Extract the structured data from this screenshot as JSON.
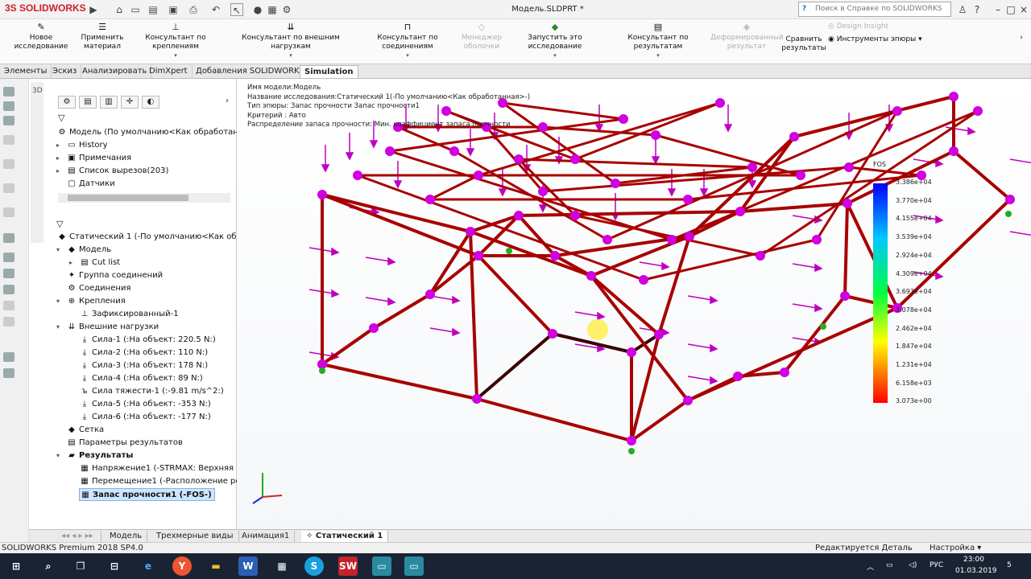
{
  "titlebar": {
    "logo": "SOLIDWORKS",
    "window_title": "Модель.SLDPRT *",
    "help_placeholder": "Поиск в Справке по SOLIDWORKS"
  },
  "commands": [
    {
      "label": "Новое исследование",
      "enabled": true
    },
    {
      "label": "Применить материал",
      "enabled": true
    },
    {
      "label": "Консультант по креплениям",
      "enabled": true
    },
    {
      "label": "Консультант по внешним нагрузкам",
      "enabled": true
    },
    {
      "label": "Консультант по соединениям",
      "enabled": true
    },
    {
      "label": "Менеджер оболочки",
      "enabled": false
    },
    {
      "label": "Запустить это исследование",
      "enabled": true
    },
    {
      "label": "Консультант по результатам",
      "enabled": true
    },
    {
      "label": "Деформированный результат",
      "enabled": false
    },
    {
      "label": "Сравнить результаты",
      "enabled": true
    },
    {
      "label": "Design Insight",
      "enabled": false
    },
    {
      "label": "Инструменты эпюры",
      "enabled": true
    }
  ],
  "tabs": [
    "Элементы",
    "Эскиз",
    "Анализировать",
    "DimXpert",
    "Добавления SOLIDWORKS",
    "Simulation"
  ],
  "active_tab": "Simulation",
  "tree_top": [
    {
      "label": "Модель  (По умолчанию<Как обработан"
    },
    {
      "label": "History"
    },
    {
      "label": "Примечания"
    },
    {
      "label": "Список вырезов(203)"
    },
    {
      "label": "Датчики"
    }
  ],
  "study_tree": [
    {
      "label": "Статический 1 (-По умолчанию<Как обрабо"
    },
    {
      "label": "Модель"
    },
    {
      "label": "Cut list"
    },
    {
      "label": "Группа соединений"
    },
    {
      "label": "Соединения"
    },
    {
      "label": "Крепления"
    },
    {
      "label": "Зафиксированный-1"
    },
    {
      "label": "Внешние нагрузки"
    },
    {
      "label": "Сила-1 (:На объект: 220.5 N:)"
    },
    {
      "label": "Сила-2 (:На объект: 110 N:)"
    },
    {
      "label": "Сила-3 (:На объект: 178 N:)"
    },
    {
      "label": "Сила-4 (:На объект: 89 N:)"
    },
    {
      "label": "Сила тяжести-1 (:-9.81 m/s^2:)"
    },
    {
      "label": "Сила-5 (:На объект: -353 N:)"
    },
    {
      "label": "Сила-6 (:На объект: -177 N:)"
    },
    {
      "label": "Сетка"
    },
    {
      "label": "Параметры результатов"
    },
    {
      "label": "Результаты"
    },
    {
      "label": "Напряжение1 (-STRMAX: Верхняя гра"
    },
    {
      "label": "Перемещение1 (-Расположение резу"
    },
    {
      "label": "Запас прочности1 (-FOS-)"
    }
  ],
  "info": [
    "Имя модели:Модель",
    "Название исследования:Статический 1(-По умолчанию<Как обработанная>-)",
    "Тип эпюры: Запас прочности Запас прочности1",
    "Критерий : Авто",
    "Распределение запаса прочности: Мин. коэффициент запаса прочности"
  ],
  "fos": {
    "title": "FOS",
    "values": [
      "3.386e+04",
      "3.770e+04",
      "4.155e+04",
      "3.539e+04",
      "2.924e+04",
      "4.309e+04",
      "3.693e+04",
      "3.078e+04",
      "2.462e+04",
      "1.847e+04",
      "1.231e+04",
      "6.158e+03",
      "3.073e+00"
    ]
  },
  "bottom_tabs": [
    "Модель",
    "Трехмерные виды",
    "Анимация1",
    "Статический 1"
  ],
  "active_bottom_tab": "Статический 1",
  "status": {
    "product": "SOLIDWORKS Premium 2018 SP4.0",
    "mode": "Редактируется Деталь",
    "settings": "Настройка"
  },
  "taskbar": {
    "lang": "РУС",
    "time": "23:00",
    "date": "01.03.2019",
    "notifications": "5"
  }
}
